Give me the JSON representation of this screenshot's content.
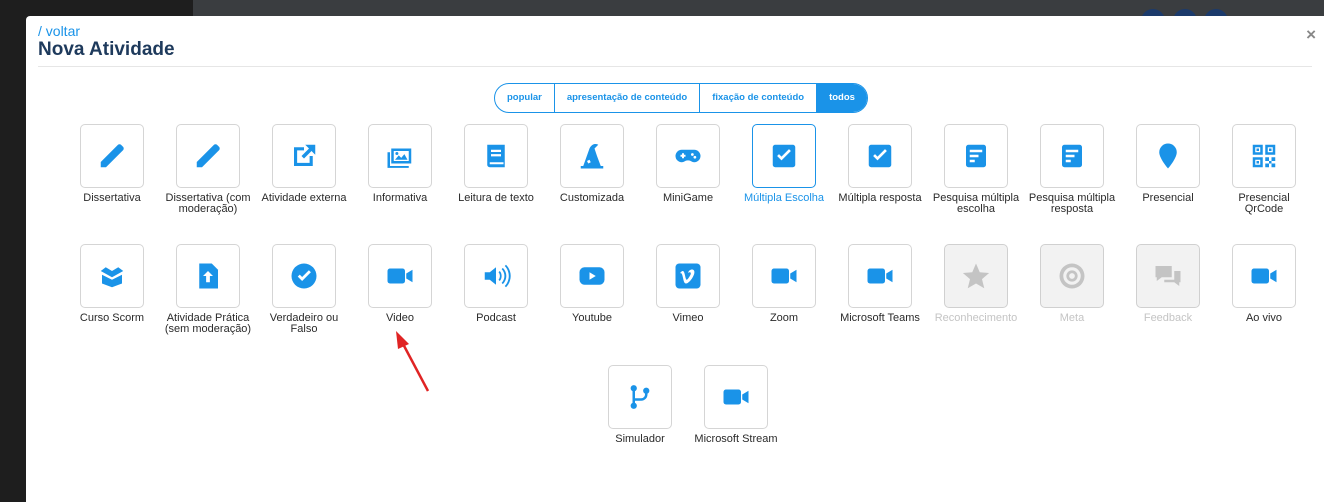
{
  "header": {
    "back_label": "/ voltar",
    "title": "Nova Atividade",
    "close_symbol": "×"
  },
  "filters": [
    {
      "label": "popular",
      "active": false
    },
    {
      "label": "apresentação de conteúdo",
      "active": false
    },
    {
      "label": "fixação de conteúdo",
      "active": false
    },
    {
      "label": "todos",
      "active": true
    }
  ],
  "activities": [
    {
      "label": "Dissertativa",
      "icon": "pencil-icon",
      "state": "normal"
    },
    {
      "label": "Dissertativa (com moderação)",
      "icon": "pencil-icon",
      "state": "normal"
    },
    {
      "label": "Atividade externa",
      "icon": "external-link-icon",
      "state": "normal"
    },
    {
      "label": "Informativa",
      "icon": "images-icon",
      "state": "normal"
    },
    {
      "label": "Leitura de texto",
      "icon": "book-icon",
      "state": "normal"
    },
    {
      "label": "Customizada",
      "icon": "wizard-hat-icon",
      "state": "normal"
    },
    {
      "label": "MiniGame",
      "icon": "gamepad-icon",
      "state": "normal"
    },
    {
      "label": "Múltipla Escolha",
      "icon": "checkbox-icon",
      "state": "selected"
    },
    {
      "label": "Múltipla resposta",
      "icon": "checkbox-icon",
      "state": "normal"
    },
    {
      "label": "Pesquisa múltipla escolha",
      "icon": "form-icon",
      "state": "normal"
    },
    {
      "label": "Pesquisa múltipla resposta",
      "icon": "form-icon",
      "state": "normal"
    },
    {
      "label": "Presencial",
      "icon": "map-pin-icon",
      "state": "normal"
    },
    {
      "label": "Presencial QrCode",
      "icon": "qrcode-icon",
      "state": "normal"
    },
    {
      "label": "Curso Scorm",
      "icon": "box-open-icon",
      "state": "normal"
    },
    {
      "label": "Atividade Prática (sem moderação)",
      "icon": "file-upload-icon",
      "state": "normal"
    },
    {
      "label": "Verdadeiro ou Falso",
      "icon": "check-circle-icon",
      "state": "normal"
    },
    {
      "label": "Video",
      "icon": "video-camera-icon",
      "state": "normal"
    },
    {
      "label": "Podcast",
      "icon": "volume-icon",
      "state": "normal"
    },
    {
      "label": "Youtube",
      "icon": "youtube-icon",
      "state": "normal"
    },
    {
      "label": "Vimeo",
      "icon": "vimeo-icon",
      "state": "normal"
    },
    {
      "label": "Zoom",
      "icon": "video-camera-icon",
      "state": "normal"
    },
    {
      "label": "Microsoft Teams",
      "icon": "video-camera-icon",
      "state": "normal"
    },
    {
      "label": "Reconhecimento",
      "icon": "star-icon",
      "state": "disabled"
    },
    {
      "label": "Meta",
      "icon": "target-icon",
      "state": "disabled"
    },
    {
      "label": "Feedback",
      "icon": "comments-icon",
      "state": "disabled"
    },
    {
      "label": "Ao vivo",
      "icon": "video-camera-icon",
      "state": "normal"
    },
    {
      "label": "Simulador",
      "icon": "code-branch-icon",
      "state": "normal"
    },
    {
      "label": "Microsoft Stream",
      "icon": "video-camera-icon",
      "state": "normal"
    }
  ],
  "colors": {
    "accent": "#1a93e8",
    "title": "#1e3a5c",
    "disabled": "#c4c4c4",
    "annotation_arrow": "#e02424"
  }
}
